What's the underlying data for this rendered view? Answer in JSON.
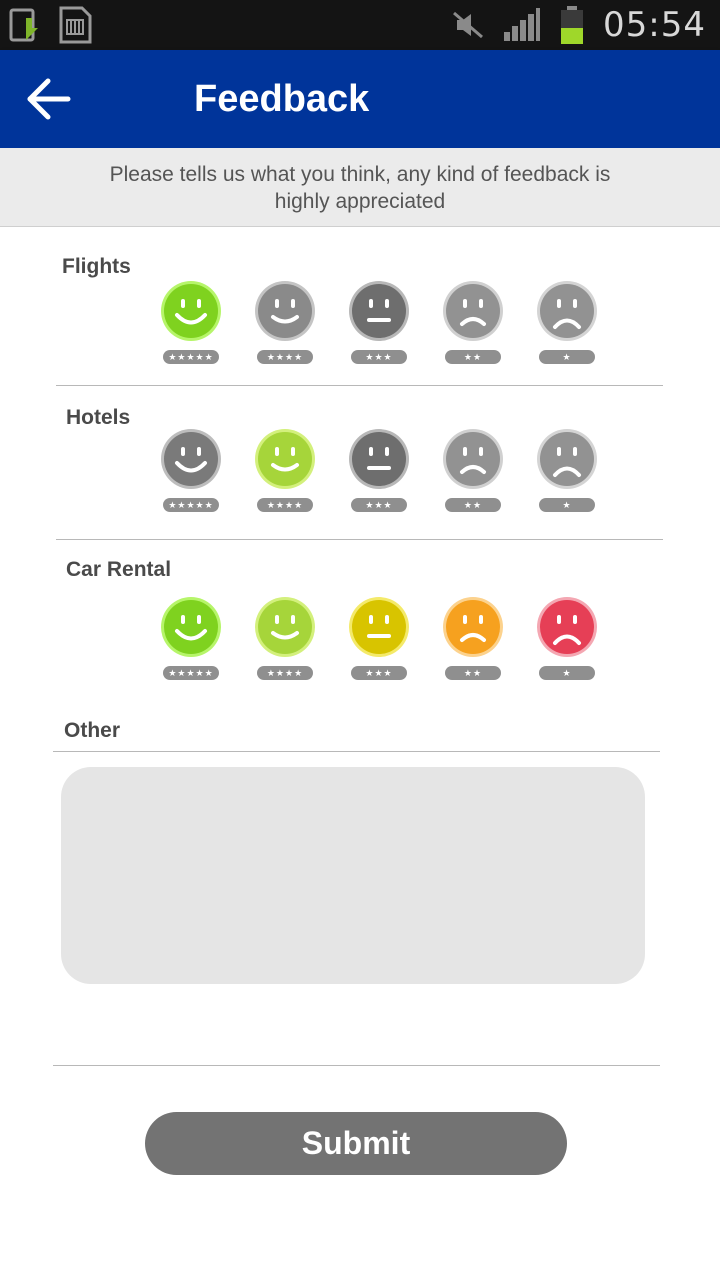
{
  "status_bar": {
    "time": "05:54",
    "icons": [
      "download-icon",
      "sim-card-icon",
      "mute-icon",
      "signal-icon",
      "battery-icon"
    ]
  },
  "app_bar": {
    "title": "Feedback",
    "back_icon": "arrow-left-icon"
  },
  "subtitle": "Please tells us what you think, any kind of feedback is highly appreciated",
  "sections": [
    {
      "label": "Flights",
      "selected_rating": 5,
      "faces": [
        {
          "stars": "★★★★★",
          "color": "#7fd21f",
          "ring": "#b6f56a",
          "expr": "big-smile"
        },
        {
          "stars": "★★★★",
          "color": "#8a8a8a",
          "ring": "#c4c4c4",
          "expr": "smile"
        },
        {
          "stars": "★★★",
          "color": "#6e6e6e",
          "ring": "#b8b8b8",
          "expr": "neutral"
        },
        {
          "stars": "★★",
          "color": "#929292",
          "ring": "#d0d0d0",
          "expr": "frown"
        },
        {
          "stars": "★",
          "color": "#929292",
          "ring": "#d4d4d4",
          "expr": "sad"
        }
      ]
    },
    {
      "label": "Hotels",
      "selected_rating": 4,
      "faces": [
        {
          "stars": "★★★★★",
          "color": "#7a7a7a",
          "ring": "#bdbdbd",
          "expr": "big-smile"
        },
        {
          "stars": "★★★★",
          "color": "#a6d53a",
          "ring": "#d3f07c",
          "expr": "smile"
        },
        {
          "stars": "★★★",
          "color": "#6e6e6e",
          "ring": "#b8b8b8",
          "expr": "neutral"
        },
        {
          "stars": "★★",
          "color": "#929292",
          "ring": "#d0d0d0",
          "expr": "frown"
        },
        {
          "stars": "★",
          "color": "#929292",
          "ring": "#d4d4d4",
          "expr": "sad"
        }
      ]
    },
    {
      "label": "Car Rental",
      "selected_rating": 0,
      "faces": [
        {
          "stars": "★★★★★",
          "color": "#7fd21f",
          "ring": "#b6f56a",
          "expr": "big-smile"
        },
        {
          "stars": "★★★★",
          "color": "#a6d53a",
          "ring": "#d3f07c",
          "expr": "smile"
        },
        {
          "stars": "★★★",
          "color": "#d8c400",
          "ring": "#f4ea6a",
          "expr": "neutral"
        },
        {
          "stars": "★★",
          "color": "#f6a11f",
          "ring": "#fcd28d",
          "expr": "frown"
        },
        {
          "stars": "★",
          "color": "#e63f56",
          "ring": "#f4a7b2",
          "expr": "sad"
        }
      ]
    }
  ],
  "other": {
    "label": "Other",
    "value": "",
    "placeholder": ""
  },
  "submit_label": "Submit"
}
